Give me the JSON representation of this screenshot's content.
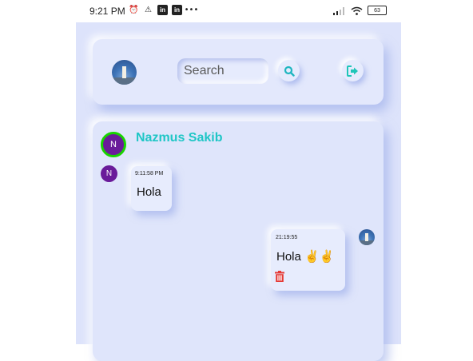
{
  "status_bar": {
    "time": "9:21 PM",
    "icons": [
      "alarm-icon",
      "warning-icon",
      "linkedin-icon",
      "linkedin-icon",
      "more-dots-icon"
    ],
    "right_icons": [
      "signal-icon",
      "wifi-icon",
      "battery-icon"
    ],
    "battery_level": "63"
  },
  "header": {
    "search_placeholder": "Search",
    "search_button_icon": "search-icon",
    "logout_button_icon": "logout-icon",
    "avatar": "user-avatar-photo"
  },
  "chat": {
    "contact_initial": "N",
    "contact_name": "Nazmus Sakib",
    "messages": [
      {
        "side": "received",
        "sender_initial": "N",
        "time": "9:11:58 PM",
        "text": "Hola"
      },
      {
        "side": "sent",
        "time": "21:19:55",
        "text": "Hola ✌✌",
        "delete_icon": "trash-icon"
      }
    ]
  },
  "colors": {
    "background": "#dde3fb",
    "accent": "#1fc6c6",
    "avatar": "#6a1b9a",
    "online_ring": "#18d400",
    "delete": "#e53935"
  }
}
